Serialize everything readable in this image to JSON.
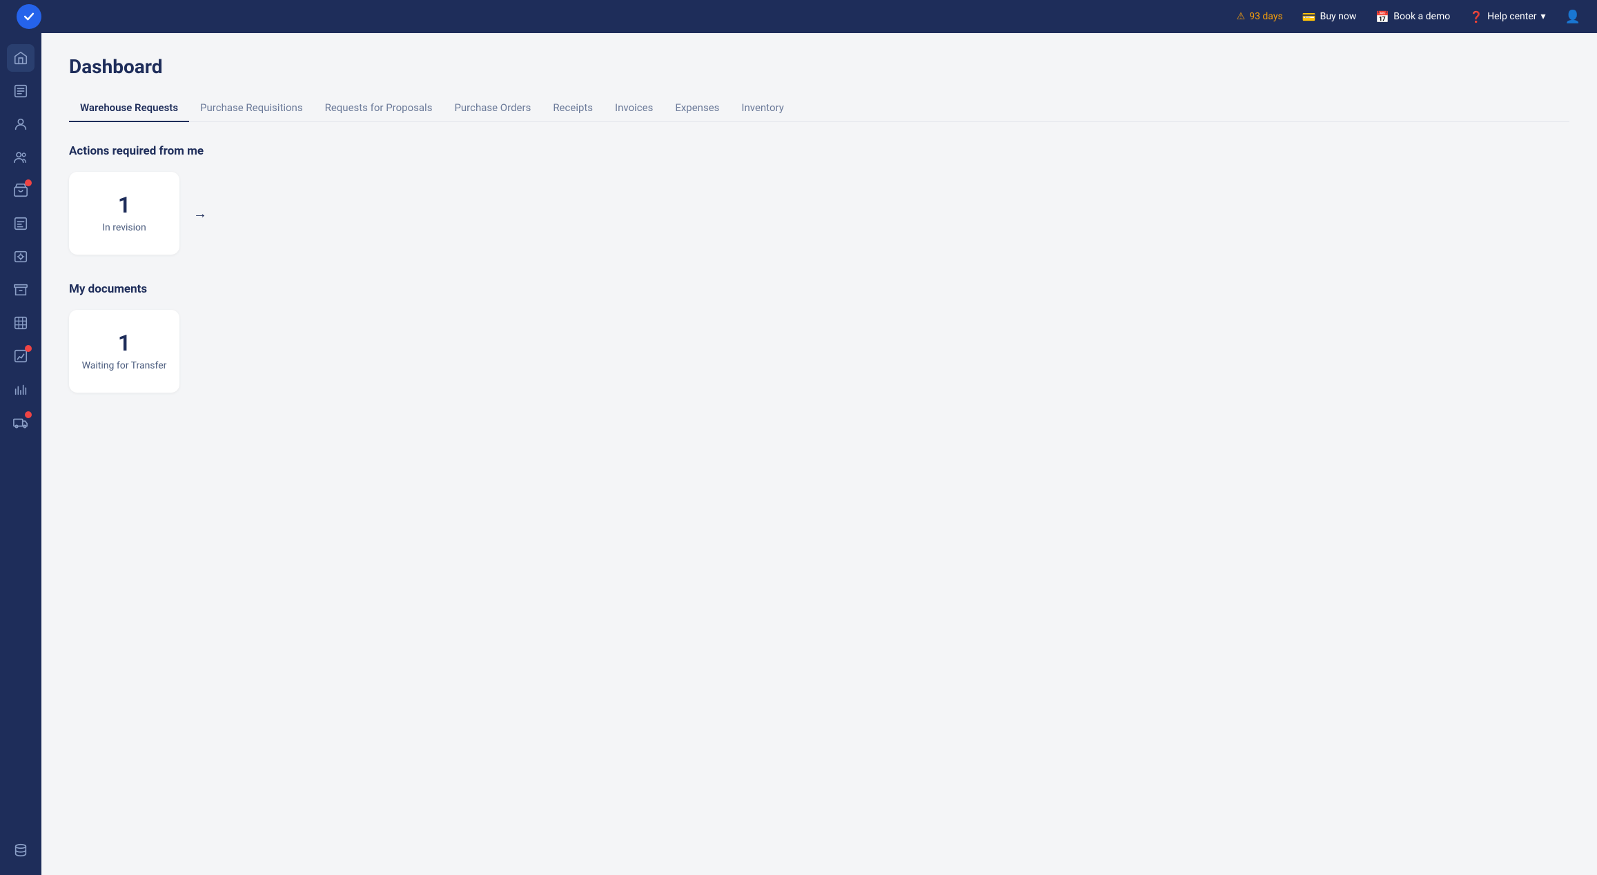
{
  "topbar": {
    "trial_warning": "93 days",
    "buy_now": "Buy now",
    "book_demo": "Book a demo",
    "help_center": "Help center"
  },
  "sidebar": {
    "icons": [
      {
        "name": "home-icon",
        "symbol": "⌂",
        "active": true
      },
      {
        "name": "orders-icon",
        "symbol": "📋",
        "active": false
      },
      {
        "name": "contacts-icon",
        "symbol": "👥",
        "active": false
      },
      {
        "name": "users-icon",
        "symbol": "👤",
        "active": false
      },
      {
        "name": "bag-icon",
        "symbol": "🛍",
        "active": false,
        "badge": true
      },
      {
        "name": "list-icon",
        "symbol": "📑",
        "active": false
      },
      {
        "name": "vault-icon",
        "symbol": "🗄",
        "active": false
      },
      {
        "name": "archive-icon",
        "symbol": "📦",
        "active": false
      },
      {
        "name": "table-icon",
        "symbol": "⊞",
        "active": false
      },
      {
        "name": "analytics-icon",
        "symbol": "📊",
        "active": false,
        "badge": true
      },
      {
        "name": "chart-icon",
        "symbol": "📈",
        "active": false
      },
      {
        "name": "truck-icon",
        "symbol": "🚚",
        "active": false,
        "badge": true
      },
      {
        "name": "db-icon",
        "symbol": "⊜",
        "active": false
      }
    ]
  },
  "page": {
    "title": "Dashboard"
  },
  "tabs": [
    {
      "label": "Warehouse Requests",
      "active": true
    },
    {
      "label": "Purchase Requisitions",
      "active": false
    },
    {
      "label": "Requests for Proposals",
      "active": false
    },
    {
      "label": "Purchase Orders",
      "active": false
    },
    {
      "label": "Receipts",
      "active": false
    },
    {
      "label": "Invoices",
      "active": false
    },
    {
      "label": "Expenses",
      "active": false
    },
    {
      "label": "Inventory",
      "active": false
    }
  ],
  "actions_section": {
    "title": "Actions required from me",
    "cards": [
      {
        "number": "1",
        "label": "In revision"
      }
    ]
  },
  "documents_section": {
    "title": "My documents",
    "cards": [
      {
        "number": "1",
        "label": "Waiting for Transfer"
      }
    ]
  }
}
